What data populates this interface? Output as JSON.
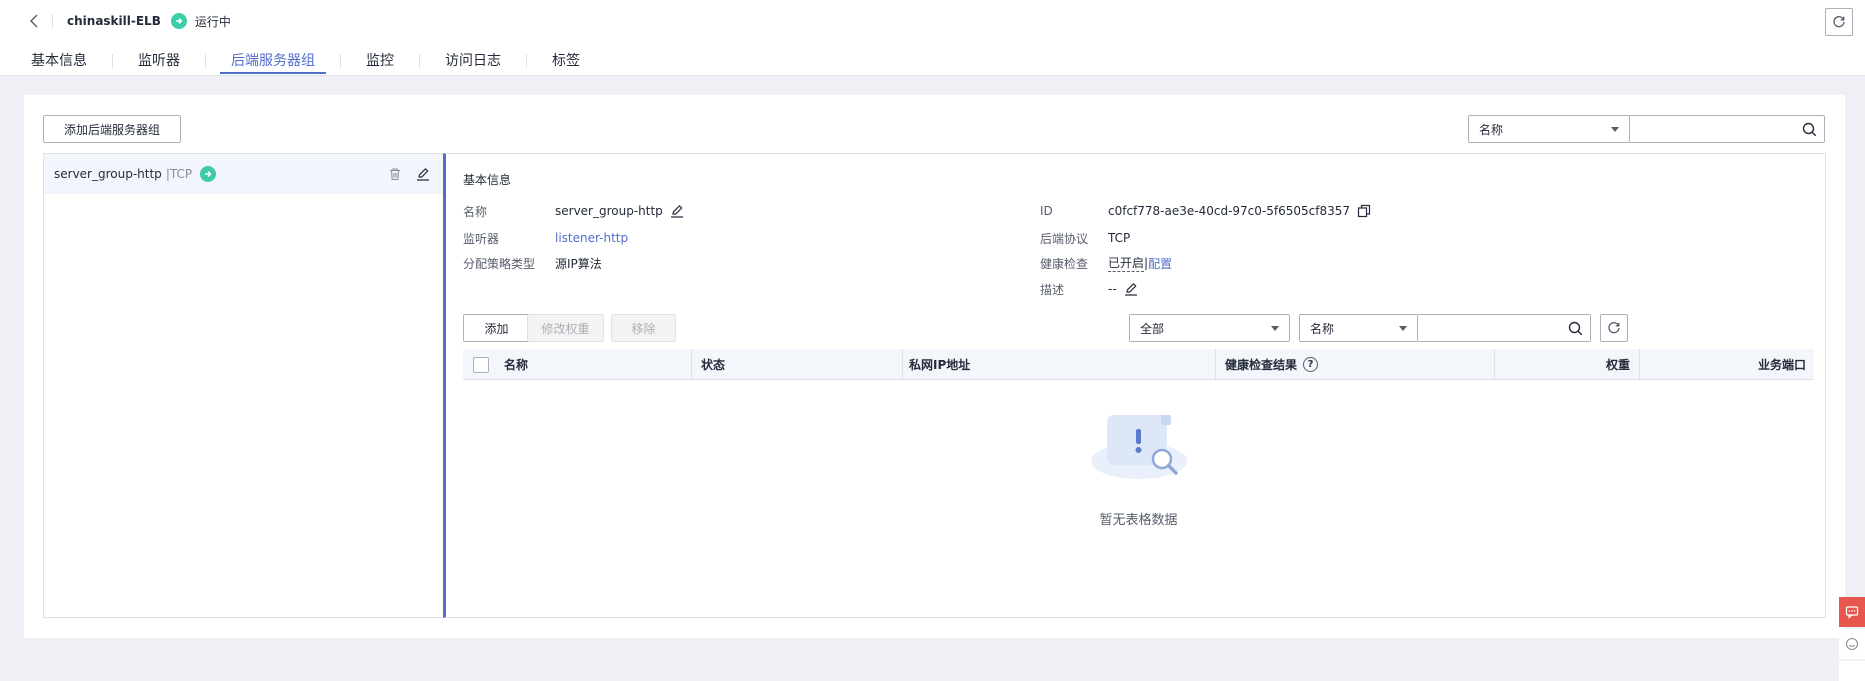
{
  "header": {
    "resource_name": "chinaskill-ELB",
    "status": "运行中"
  },
  "tabs": [
    {
      "label": "基本信息"
    },
    {
      "label": "监听器"
    },
    {
      "label": "后端服务器组",
      "active": true
    },
    {
      "label": "监控"
    },
    {
      "label": "访问日志"
    },
    {
      "label": "标签"
    }
  ],
  "toolbar": {
    "add_group_label": "添加后端服务器组",
    "search_field_selected": "名称",
    "search_value": ""
  },
  "server_groups": [
    {
      "name": "server_group-http",
      "separator": " | ",
      "protocol": "TCP"
    }
  ],
  "detail": {
    "section_title": "基本信息",
    "name_label": "名称",
    "name_value": "server_group-http",
    "listener_label": "监听器",
    "listener_value": "listener-http",
    "algorithm_label": "分配策略类型",
    "algorithm_value": "源IP算法",
    "id_label": "ID",
    "id_value": "c0fcf778-ae3e-40cd-97c0-5f6505cf8357",
    "protocol_label": "后端协议",
    "protocol_value": "TCP",
    "health_label": "健康检查",
    "health_value": "已开启",
    "health_separator": " | ",
    "health_config_link": "配置",
    "desc_label": "描述",
    "desc_value": "--"
  },
  "members": {
    "add_label": "添加",
    "modify_weight_label": "修改权重",
    "remove_label": "移除",
    "filter_selected": "全部",
    "search_field_selected": "名称",
    "search_value": "",
    "columns": {
      "name": "名称",
      "status": "状态",
      "private_ip": "私网IP地址",
      "health_result": "健康检查结果",
      "weight": "权重",
      "port": "业务端口"
    },
    "rows": [],
    "empty_text": "暂无表格数据"
  },
  "colors": {
    "primary": "#526ecc",
    "running": "#3dcca6",
    "feedback": "#e8574d"
  }
}
